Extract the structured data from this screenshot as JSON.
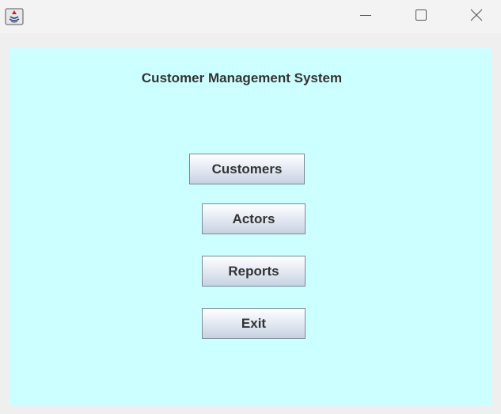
{
  "window": {
    "controls": {
      "minimize_icon": "minimize-icon",
      "maximize_icon": "maximize-icon",
      "close_icon": "close-icon"
    },
    "app_icon": "java-icon"
  },
  "main": {
    "title": "Customer Management System",
    "buttons": [
      {
        "label": "Customers"
      },
      {
        "label": "Actors"
      },
      {
        "label": "Reports"
      },
      {
        "label": "Exit"
      }
    ]
  },
  "colors": {
    "content_background": "#ccffff",
    "titlebar_background": "#f3f3f3",
    "text": "#333333"
  }
}
